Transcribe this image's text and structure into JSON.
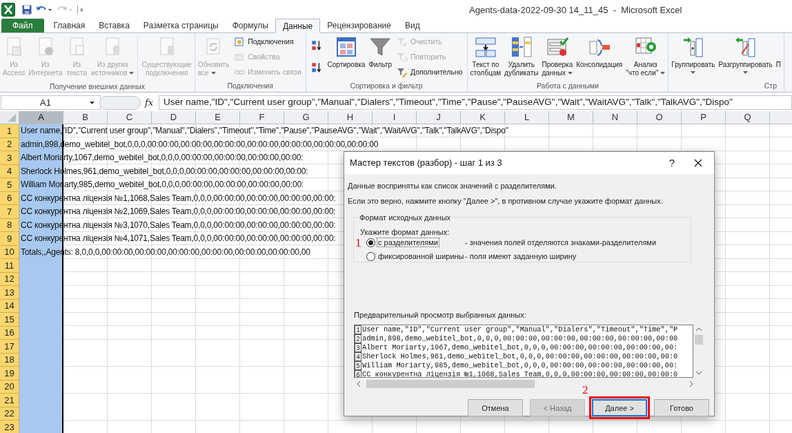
{
  "window": {
    "title": "Agents-data-2022-09-30 14_11_45  -  Microsoft Excel"
  },
  "quick_access": [
    {
      "kind": "logo",
      "disabled": false
    },
    {
      "kind": "save",
      "disabled": false
    },
    {
      "kind": "undo",
      "disabled": false
    },
    {
      "kind": "redo",
      "disabled": true
    },
    {
      "kind": "customize",
      "disabled": false
    }
  ],
  "tabs": [
    {
      "label": "Файл",
      "kind": "file",
      "selected": false
    },
    {
      "label": "Главная",
      "kind": "tab",
      "selected": false
    },
    {
      "label": "Вставка",
      "kind": "tab",
      "selected": false
    },
    {
      "label": "Разметка страницы",
      "kind": "tab",
      "selected": false
    },
    {
      "label": "Формулы",
      "kind": "tab",
      "selected": false
    },
    {
      "label": "Данные",
      "kind": "tab",
      "selected": true
    },
    {
      "label": "Рецензирование",
      "kind": "tab",
      "selected": false
    },
    {
      "label": "Вид",
      "kind": "tab",
      "selected": false
    }
  ],
  "ribbon": {
    "groups": [
      {
        "label": "Получение внешних данных",
        "items": [
          {
            "kind": "large",
            "label": "Из\nAccess",
            "disabled": true,
            "dropdown": false
          },
          {
            "kind": "large",
            "label": "Из\nИнтернета",
            "disabled": true,
            "dropdown": false
          },
          {
            "kind": "large",
            "label": "Из\nтекста",
            "disabled": true,
            "dropdown": false
          },
          {
            "kind": "large",
            "label": "Из других\nисточников",
            "disabled": true,
            "dropdown": true
          },
          {
            "kind": "separator"
          },
          {
            "kind": "large",
            "label": "Существующие\nподключения",
            "disabled": true,
            "dropdown": false
          }
        ]
      },
      {
        "label": "Подключения",
        "items": [
          {
            "kind": "large",
            "label": "Обновить\nвсе",
            "disabled": true,
            "dropdown": true
          },
          {
            "kind": "stack",
            "items": [
              {
                "kind": "small",
                "label": "Подключения",
                "disabled": false
              },
              {
                "kind": "small",
                "label": "Свойства",
                "disabled": true
              },
              {
                "kind": "small",
                "label": "Изменить связи",
                "disabled": true
              }
            ]
          }
        ]
      },
      {
        "label": "Сортировка и фильтр",
        "items": [
          {
            "kind": "stack",
            "items": [
              {
                "kind": "icon",
                "disabled": false
              },
              {
                "kind": "icon",
                "disabled": false
              }
            ]
          },
          {
            "kind": "large",
            "label": "Сортировка",
            "disabled": false,
            "dropdown": false
          },
          {
            "kind": "large",
            "label": "Фильтр",
            "disabled": false,
            "dropdown": false
          },
          {
            "kind": "stack",
            "items": [
              {
                "kind": "small",
                "label": "Очистить",
                "disabled": true
              },
              {
                "kind": "small",
                "label": "Повторить",
                "disabled": true
              },
              {
                "kind": "small",
                "label": "Дополнительно",
                "disabled": false
              }
            ]
          }
        ]
      },
      {
        "label": "Работа с данными",
        "items": [
          {
            "kind": "large",
            "label": "Текст по\nстолбцам",
            "disabled": false,
            "dropdown": false
          },
          {
            "kind": "large",
            "label": "Удалить\nдубликаты",
            "disabled": false,
            "dropdown": false
          },
          {
            "kind": "large",
            "label": "Проверка\nданных",
            "disabled": false,
            "dropdown": true
          },
          {
            "kind": "large",
            "label": "Консолидация",
            "disabled": false,
            "dropdown": false
          },
          {
            "kind": "large",
            "label": "Анализ\n\"что если\"",
            "disabled": false,
            "dropdown": true
          }
        ]
      },
      {
        "label": "Стр",
        "items": [
          {
            "kind": "large",
            "label": "Группировать",
            "disabled": false,
            "dropdown": true
          },
          {
            "kind": "large",
            "label": "Разгруппировать",
            "disabled": false,
            "dropdown": true
          },
          {
            "kind": "large",
            "label": "П",
            "disabled": false,
            "dropdown": false
          }
        ]
      }
    ]
  },
  "formula_bar": {
    "name_box": "A1",
    "fx": "fx",
    "formula": "User name,\"ID\",\"Current user group\",\"Manual\",\"Dialers\",\"Timeout\",\"Time\",\"Pause\",\"PauseAVG\",\"Wait\",\"WaitAVG\",\"Talk\",\"TalkAVG\",\"Dispo\""
  },
  "sheet": {
    "columns": [
      {
        "label": "A",
        "selected": true
      },
      {
        "label": "B",
        "selected": false
      },
      {
        "label": "C",
        "selected": false
      },
      {
        "label": "D",
        "selected": false
      },
      {
        "label": "E",
        "selected": false
      },
      {
        "label": "F",
        "selected": false
      },
      {
        "label": "G",
        "selected": false
      },
      {
        "label": "H",
        "selected": false
      },
      {
        "label": "I",
        "selected": false
      },
      {
        "label": "J",
        "selected": false
      },
      {
        "label": "K",
        "selected": false
      },
      {
        "label": "L",
        "selected": false
      },
      {
        "label": "M",
        "selected": false
      },
      {
        "label": "N",
        "selected": false
      },
      {
        "label": "O",
        "selected": false
      },
      {
        "label": "P",
        "selected": false
      },
      {
        "label": "Q",
        "selected": false
      }
    ],
    "rows": [
      {
        "number": "1",
        "text": "User name,\"ID\",\"Current user group\",\"Manual\",\"Dialers\",\"Timeout\",\"Time\",\"Pause\",\"PauseAVG\",\"Wait\",\"WaitAVG\",\"Talk\",\"TalkAVG\",\"Dispo\""
      },
      {
        "number": "2",
        "text": "admin,898,demo_webitel_bot,0,0,0,00:00:00,00:00:00,00:00:00,00:00:00,00:00:00,00:00:00,00:00:00"
      },
      {
        "number": "3",
        "text": "Albert Moriarty,1067,demo_webitel_bot,0,0,0,00:00:00,00:00:00,00:00:00,00:00:"
      },
      {
        "number": "4",
        "text": "Sherlock Holmes,961,demo_webitel_bot,0,0,0,00:00:00,00:00:00,00:00:00,00:00:"
      },
      {
        "number": "5",
        "text": "William Moriarty,985,demo_webitel_bot,0,0,0,00:00:00,00:00:00,00:00:00,00:00:"
      },
      {
        "number": "6",
        "text": "CC конкурентна ліцензія №1,1068,Sales Team,0,0,0,00:00:00,00:00:00,00:00:00,00:00:"
      },
      {
        "number": "7",
        "text": "CC конкурентна ліцензія №2,1069,Sales Team,0,0,0,00:00:00,00:00:00,00:00:00,00:00:"
      },
      {
        "number": "8",
        "text": "CC конкурентна ліцензія №3,1070,Sales Team,0,0,0,00:00:00,00:00:00,00:00:00,00:00:"
      },
      {
        "number": "9",
        "text": "CC конкурентна ліцензія №4,1071,Sales Team,0,0,0,00:00:00,00:00:00,00:00:00,00:00:"
      },
      {
        "number": "10",
        "text": "Totals,,Agents: 8,0,0,0,00:00:00,00:00:00,00:00:00,00:00:00,00:00:00,00:00:00,00"
      },
      {
        "number": "11"
      },
      {
        "number": "12"
      },
      {
        "number": "13"
      },
      {
        "number": "14"
      },
      {
        "number": "15"
      },
      {
        "number": "16"
      },
      {
        "number": "17"
      },
      {
        "number": "18"
      },
      {
        "number": "19"
      },
      {
        "number": "20"
      },
      {
        "number": "21"
      },
      {
        "number": "22"
      },
      {
        "number": "23"
      }
    ]
  },
  "dialog": {
    "title": "Мастер текстов (разбор) - шаг 1 из 3",
    "help": "?",
    "intro": [
      "Данные восприняты как список значений с разделителями.",
      "Если это верно, нажмите кнопку \"Далее >\", в противном случае укажите формат данных."
    ],
    "group_title": "Формат исходных данных",
    "prompt": "Укажите формат данных:",
    "options": [
      {
        "label": "с разделителями",
        "description": "- значения полей отделяются знаками-разделителями",
        "selected": true,
        "marker": "1"
      },
      {
        "label": "фиксированной ширины",
        "description": "- поля имеют заданную ширину",
        "selected": false
      }
    ],
    "preview_label": "Предварительный просмотр выбранных данных:",
    "preview": [
      {
        "number": "1",
        "text": "User name,\"ID\",\"Current user group\",\"Manual\",\"Dialers\",\"Timeout\",\"Time\",\"P"
      },
      {
        "number": "2",
        "text": "admin,898,demo_webitel_bot,0,0,0,00:00:00,00:00:00,00:00:00,00:00:00,00:00"
      },
      {
        "number": "3",
        "text": "Albert Moriarty,1067,demo_webitel_bot,0,0,0,00:00:00,00:00:00,00:00:00,00:"
      },
      {
        "number": "4",
        "text": "Sherlock Holmes,961,demo_webitel_bot,0,0,0,00:00:00,00:00:00,00:00:00,00:0"
      },
      {
        "number": "5",
        "text": "William Moriarty,985,demo_webitel_bot,0,0,0,00:00:00,00:00:00,00:00:00,00:"
      },
      {
        "number": "6",
        "text": "CC конкурентна ліцензія №1,1068,Sales Team,0,0,0,00:00:00,00:00:00,00:00:0"
      }
    ],
    "buttons": [
      {
        "label": "Отмена",
        "disabled": false,
        "default": false
      },
      {
        "label": "< Назад",
        "disabled": true,
        "default": false
      },
      {
        "label": "Далее >",
        "disabled": false,
        "default": true,
        "marker": "2"
      },
      {
        "label": "Готово",
        "disabled": false,
        "default": false
      }
    ]
  }
}
